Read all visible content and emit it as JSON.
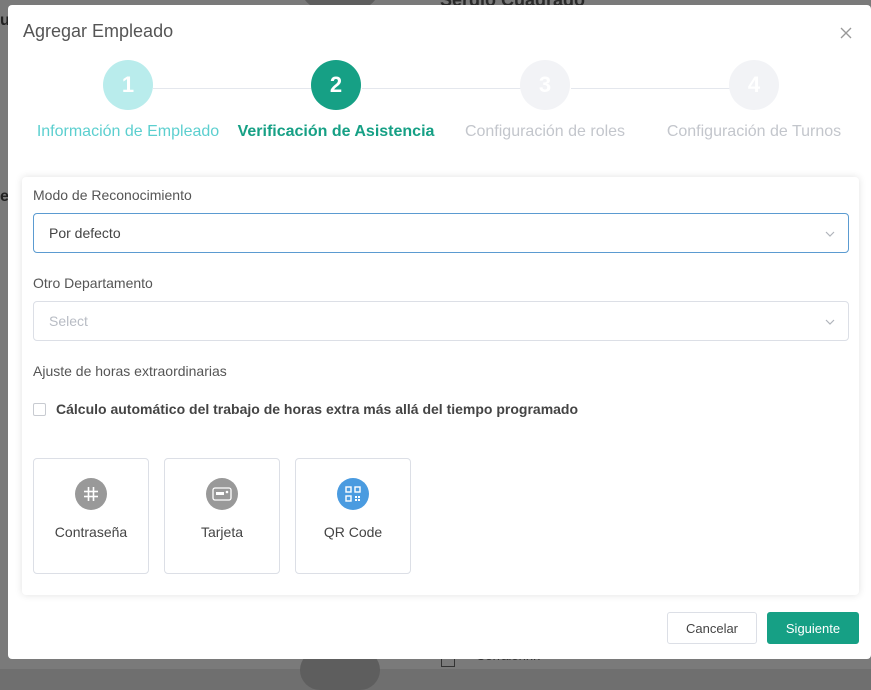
{
  "background": {
    "name_partial": "Sergio Cuadrado",
    "left_char_top": "u",
    "left_char_mid": "e",
    "bottom_text": "Corraionnn"
  },
  "modal": {
    "title": "Agregar Empleado",
    "close_icon": "close-icon"
  },
  "steps": [
    {
      "number": "1",
      "label": "Información de Empleado",
      "state": "done"
    },
    {
      "number": "2",
      "label": "Verificación de Asistencia",
      "state": "active"
    },
    {
      "number": "3",
      "label": "Configuración de roles",
      "state": "todo"
    },
    {
      "number": "4",
      "label": "Configuración de Turnos",
      "state": "todo"
    }
  ],
  "form": {
    "recognition_mode": {
      "label": "Modo de Reconocimiento",
      "value": "Por defecto"
    },
    "other_department": {
      "label": "Otro Departamento",
      "placeholder": "Select"
    },
    "overtime": {
      "label": "Ajuste de horas extraordinarias",
      "checkbox_label": "Cálculo automático del trabajo de horas extra más allá del tiempo programado",
      "checked": false
    },
    "methods": [
      {
        "label": "Contraseña",
        "icon": "hash-icon",
        "color": "#999999"
      },
      {
        "label": "Tarjeta",
        "icon": "card-icon",
        "color": "#999999"
      },
      {
        "label": "QR Code",
        "icon": "qr-code-icon",
        "color": "#4a9be0"
      }
    ]
  },
  "footer": {
    "cancel_label": "Cancelar",
    "next_label": "Siguiente"
  },
  "colors": {
    "accent": "#16a085",
    "step_done": "#5ccfcf",
    "step_todo": "#c3c6cc",
    "focus_border": "#5b9bd1"
  }
}
